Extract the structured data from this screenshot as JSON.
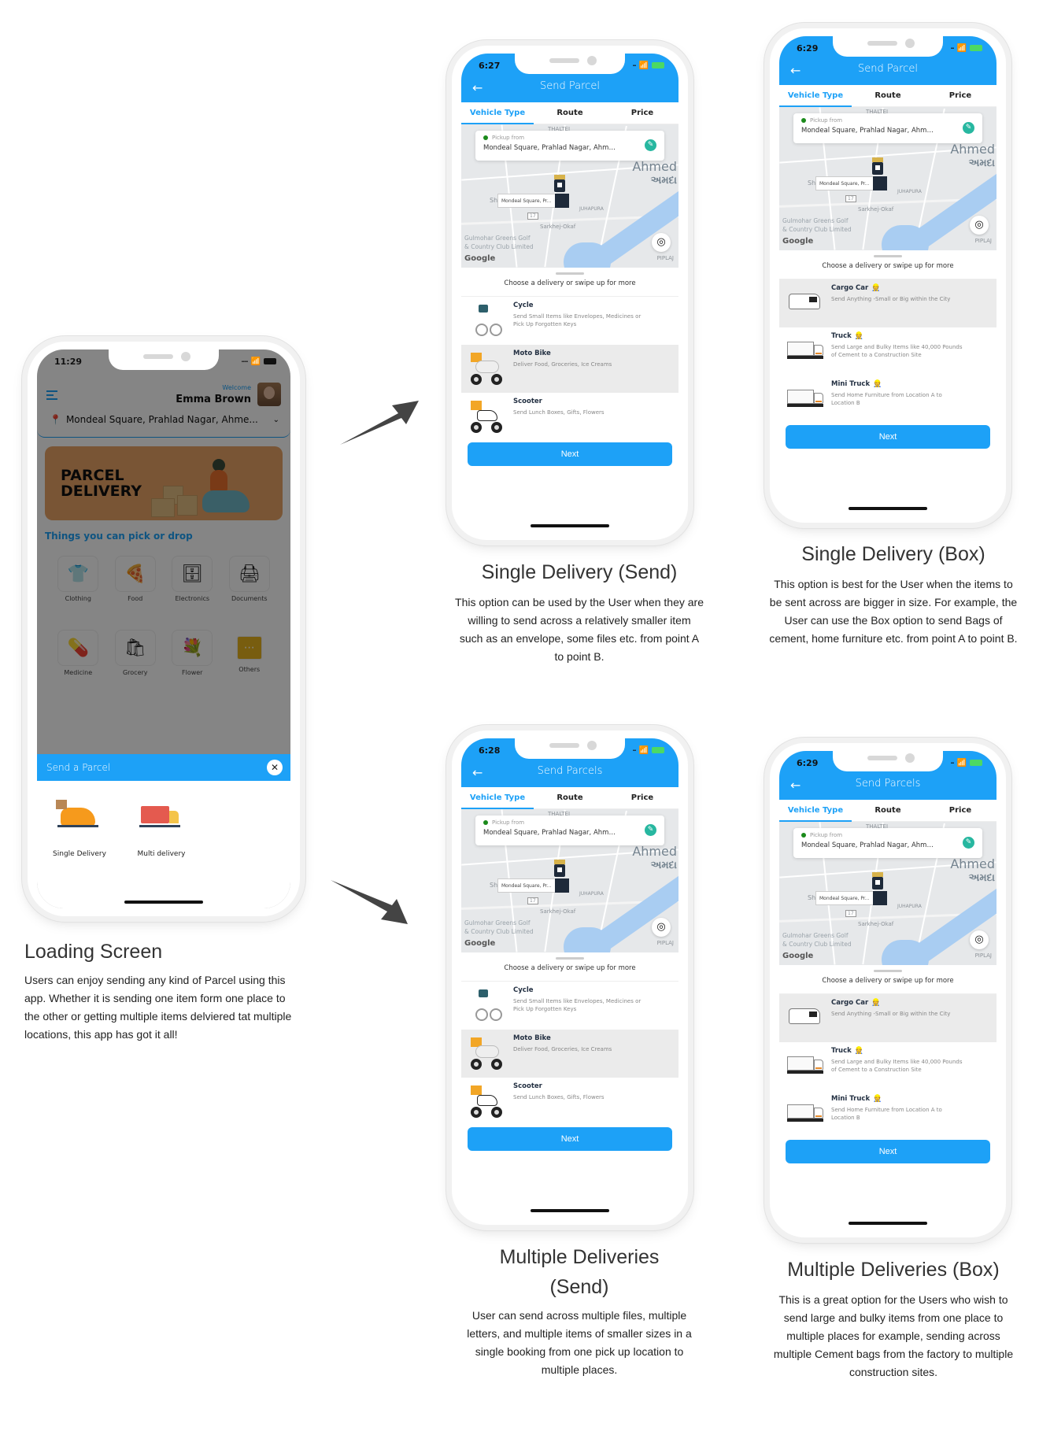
{
  "home_phone": {
    "status_time": "11:29",
    "welcome": "Welcome",
    "user_name": "Emma Brown",
    "location": "Mondeal Square, Prahlad Nagar, Ahme...",
    "banner_title_1": "PARCEL",
    "banner_title_2": "DELIVERY",
    "section_title": "Things you can pick or drop",
    "categories": [
      {
        "label": "Clothing",
        "icon": "👕"
      },
      {
        "label": "Food",
        "icon": "🍕"
      },
      {
        "label": "Electronics",
        "icon": "🗄"
      },
      {
        "label": "Documents",
        "icon": "🖨"
      },
      {
        "label": "Medicine",
        "icon": "💊"
      },
      {
        "label": "Grocery",
        "icon": "🛍"
      },
      {
        "label": "Flower",
        "icon": "💐"
      },
      {
        "label": "Others",
        "icon": "⋯"
      }
    ],
    "modal_title": "Send a Parcel",
    "options": [
      "Single Delivery",
      "Multi delivery"
    ]
  },
  "phones": [
    {
      "id": "single-send",
      "status_time": "6:27",
      "title": "Send Parcel",
      "tabs": [
        "Vehicle Type",
        "Route",
        "Price"
      ],
      "pickup_label": "Pickup from",
      "pickup_address": "Mondeal Square, Prahlad Nagar, Ahmeda...",
      "pin_label": "Mondeal Square, Pr...",
      "hint": "Choose a delivery or swipe up for more",
      "vehicles": [
        {
          "name": "Cycle",
          "desc": "Send Small Items like Envelopes, Medicines or Pick Up Forgotten Keys"
        },
        {
          "name": "Moto Bike",
          "desc": "Deliver Food, Groceries, Ice Creams"
        },
        {
          "name": "Scooter",
          "desc": "Send Lunch Boxes, Gifts, Flowers"
        }
      ],
      "next": "Next"
    },
    {
      "id": "single-box",
      "status_time": "6:29",
      "title": "Send Parcel",
      "tabs": [
        "Vehicle Type",
        "Route",
        "Price"
      ],
      "pickup_label": "Pickup from",
      "pickup_address": "Mondeal Square, Prahlad Nagar, Ahmeda...",
      "pin_label": "Mondeal Square, Pr...",
      "hint": "Choose a delivery or swipe up for more",
      "vehicles": [
        {
          "name": "Cargo Car",
          "desc": "Send Anything -Small or Big within the City"
        },
        {
          "name": "Truck",
          "desc": "Send Large and Bulky Items like 40,000 Pounds of Cement to a Construction Site"
        },
        {
          "name": "Mini Truck",
          "desc": "Send Home Furniture from Location A to Location B"
        }
      ],
      "next": "Next"
    },
    {
      "id": "multi-send",
      "status_time": "6:28",
      "title": "Send Parcels",
      "tabs": [
        "Vehicle Type",
        "Route",
        "Price"
      ],
      "pickup_label": "Pickup from",
      "pickup_address": "Mondeal Square, Prahlad Nagar, Ahmeda...",
      "pin_label": "Mondeal Square, Pr...",
      "hint": "Choose a delivery or swipe up for more",
      "vehicles": [
        {
          "name": "Cycle",
          "desc": "Send Small Items like Envelopes, Medicines or Pick Up Forgotten Keys"
        },
        {
          "name": "Moto Bike",
          "desc": "Deliver Food, Groceries, Ice Creams"
        },
        {
          "name": "Scooter",
          "desc": "Send Lunch Boxes, Gifts, Flowers"
        }
      ],
      "next": "Next"
    },
    {
      "id": "multi-box",
      "status_time": "6:29",
      "title": "Send Parcels",
      "tabs": [
        "Vehicle Type",
        "Route",
        "Price"
      ],
      "pickup_label": "Pickup from",
      "pickup_address": "Mondeal Square, Prahlad Nagar, Ahmeda...",
      "pin_label": "Mondeal Square, Pr...",
      "hint": "Choose a delivery or swipe up for more",
      "vehicles": [
        {
          "name": "Cargo Car",
          "desc": "Send Anything -Small or Big within the City"
        },
        {
          "name": "Truck",
          "desc": "Send Large and Bulky Items like 40,000 Pounds of Cement to a Construction Site"
        },
        {
          "name": "Mini Truck",
          "desc": "Send Home Furniture from Location A to Location B"
        }
      ],
      "next": "Next"
    }
  ],
  "map_labels": {
    "city": "Ahmed",
    "city_gu": "અમદા",
    "thaltej": "THALTEJ",
    "juhapura": "JUHAPURA",
    "sarkhej": "Sarkhej-Okaf",
    "golf": "Gulmohar Greens Golf",
    "club": "& Country Club Limited",
    "piplaj": "PIPLAJ",
    "highway": "17",
    "google": "Google",
    "she": "She"
  },
  "captions": {
    "loading": {
      "title": "Loading Screen",
      "body": "Users can enjoy sending any kind of Parcel using this app. Whether it is sending one item form one place to the other or getting multiple items delviered tat multiple locations, this app has got it all!"
    },
    "single_send": {
      "title": "Single Delivery (Send)",
      "body": "This option can be used by the User when they are willing to send across a relatively smaller item such as an envelope, some files etc. from point A to point B."
    },
    "single_box": {
      "title": "Single Delivery (Box)",
      "body": "This option is best for the User when the items to be sent across are bigger in size. For example, the User can use the Box option to send Bags of cement, home furniture etc. from point A to point B."
    },
    "multi_send": {
      "title": "Multiple Deliveries (Send)",
      "body": "User can send across multiple files, multiple letters, and multiple items of smaller sizes in a single booking from one pick up location to multiple places."
    },
    "multi_box": {
      "title": "Multiple Deliveries (Box)",
      "body": "This is a great option for the Users who wish to send large and bulky items from one place to multiple places for example, sending across multiple Cement bags from the factory to multiple construction sites."
    }
  },
  "colors": {
    "primary": "#1da1f7",
    "pickup_dot": "#1b8a1b",
    "edit": "#27b7a0",
    "arrow": "#444444"
  }
}
